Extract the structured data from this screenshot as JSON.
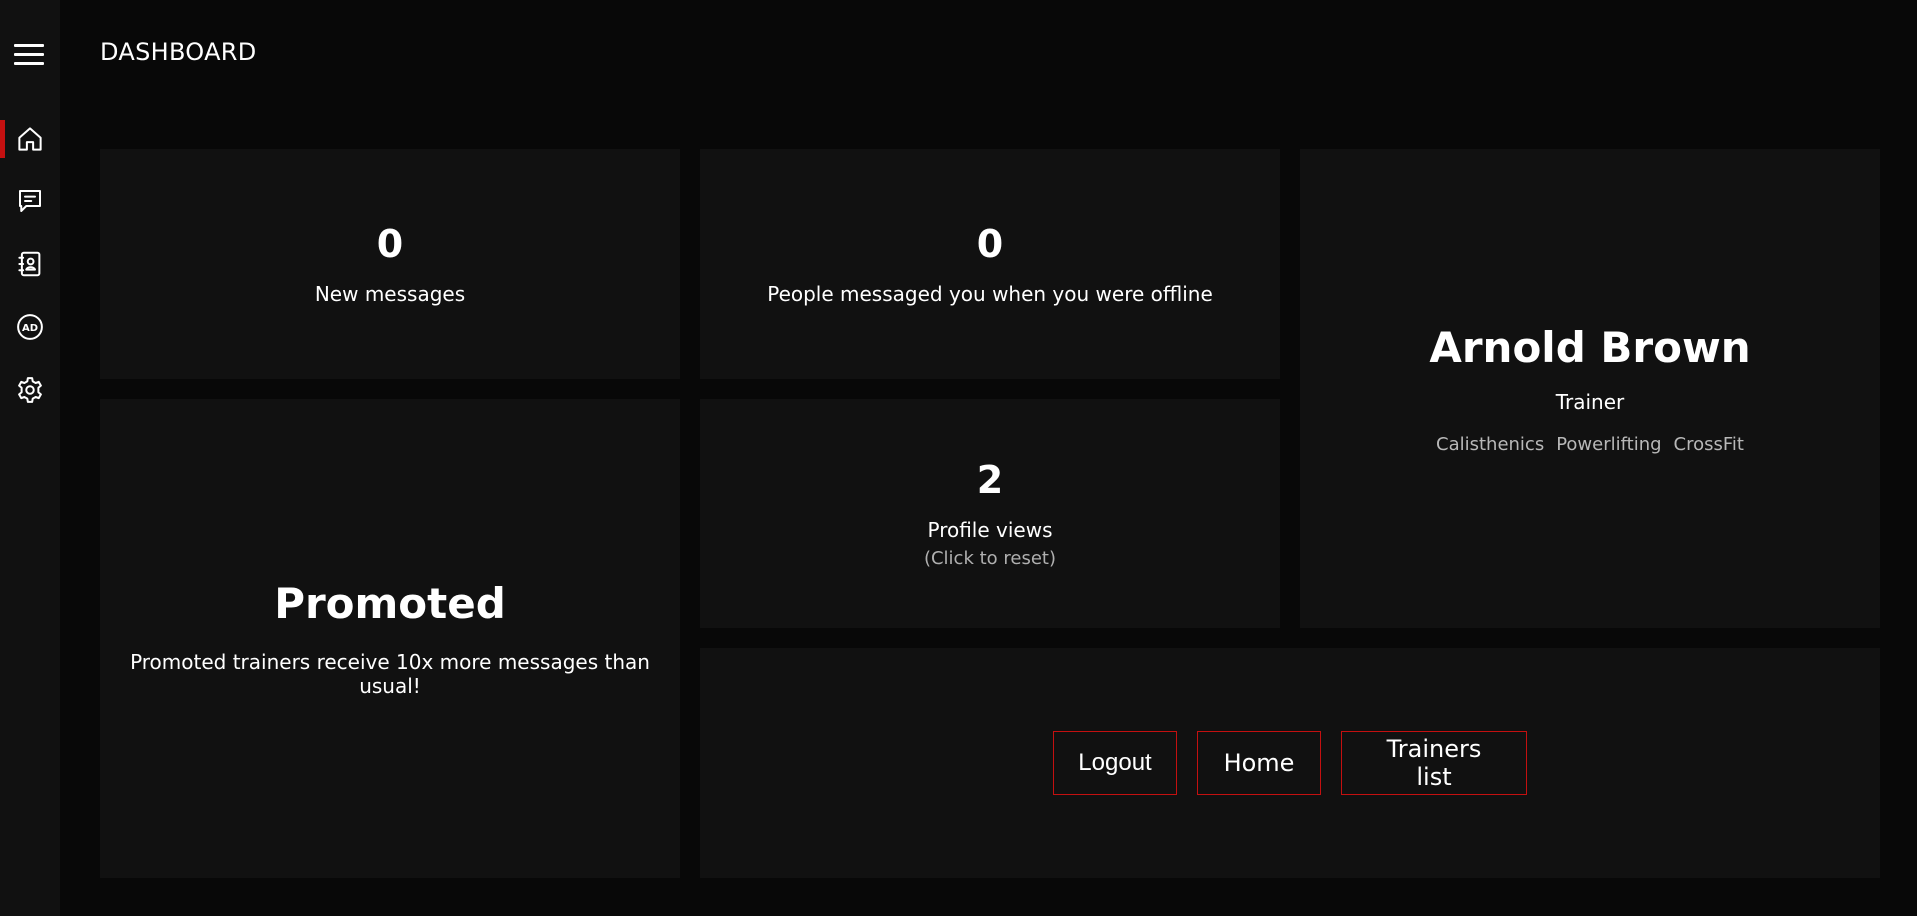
{
  "header": {
    "title": "DASHBOARD"
  },
  "sidebar": {
    "items": [
      {
        "icon": "home-icon",
        "active": true
      },
      {
        "icon": "chat-icon",
        "active": false
      },
      {
        "icon": "contacts-icon",
        "active": false
      },
      {
        "icon": "ad-icon",
        "active": false
      },
      {
        "icon": "gear-icon",
        "active": false
      }
    ],
    "active_color": "#c41010"
  },
  "stats": {
    "new_messages": {
      "value": "0",
      "label": "New messages"
    },
    "offline_messages": {
      "value": "0",
      "label": "People messaged you when you were offline"
    },
    "profile_views": {
      "value": "2",
      "label": "Profile views",
      "hint": "(Click to reset)"
    }
  },
  "profile": {
    "name": "Arnold Brown",
    "role": "Trainer",
    "tags": [
      "Calisthenics",
      "Powerlifting",
      "CrossFit"
    ]
  },
  "promoted": {
    "title": "Promoted",
    "text": "Promoted trainers receive 10x more messages than usual!"
  },
  "actions": {
    "logout_label": "Logout",
    "home_label": "Home",
    "trainers_label": "Trainers list"
  },
  "colors": {
    "background": "#080808",
    "card": "#111111",
    "accent": "#c41010"
  }
}
